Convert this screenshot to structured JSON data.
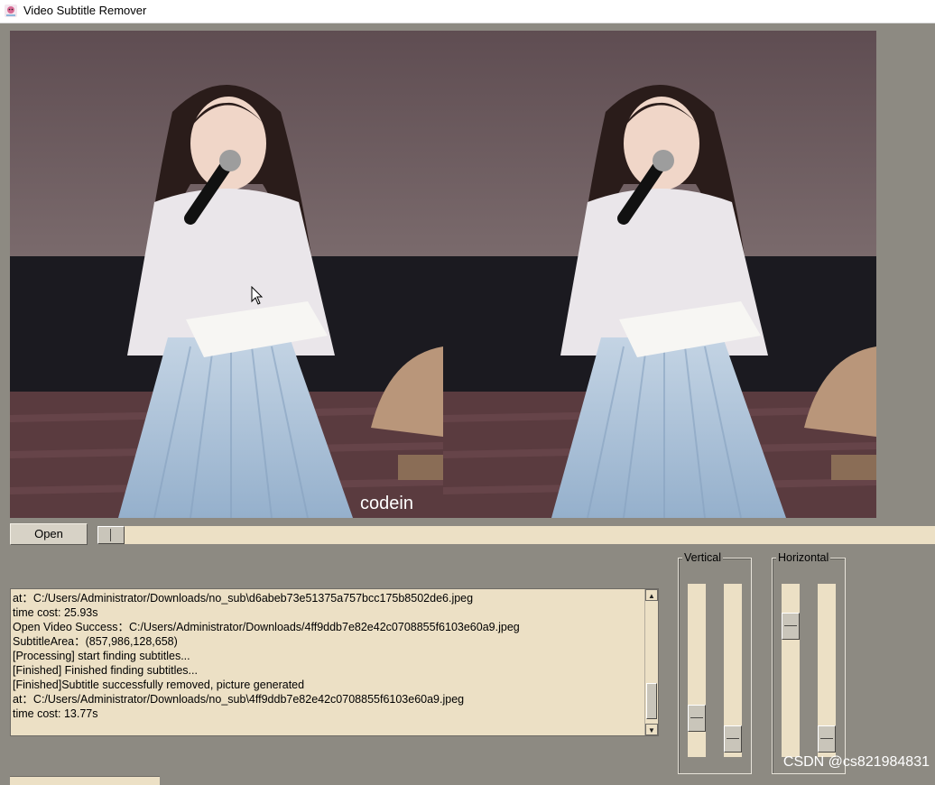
{
  "window": {
    "title": "Video Subtitle Remover",
    "icon": "app-icon"
  },
  "preview": {
    "left_frame": "original-frame",
    "right_frame": "processed-frame",
    "logo_text": "codein"
  },
  "controls": {
    "open_label": "Open",
    "progress": 0
  },
  "log": {
    "lines": [
      "at：C:/Users/Administrator/Downloads/no_sub\\d6abeb73e51375a757bcc175b8502de6.jpeg",
      "time cost: 25.93s",
      "Open Video Success：C:/Users/Administrator/Downloads/4ff9ddb7e82e42c0708855f6103e60a9.jpeg",
      "SubtitleArea：(857,986,128,658)",
      "[Processing] start finding subtitles...",
      "[Finished] Finished finding subtitles...",
      "[Finished]Subtitle successfully removed, picture generated",
      "at：C:/Users/Administrator/Downloads/no_sub\\4ff9ddb7e82e42c0708855f6103e60a9.jpeg",
      "time cost: 13.77s"
    ],
    "scroll_up_glyph": "▲",
    "scroll_down_glyph": "▼"
  },
  "sliders": {
    "vertical_label": "Vertical",
    "horizontal_label": "Horizontal",
    "vertical": [
      {
        "name": "vertical-slider-1",
        "level": 0.83
      },
      {
        "name": "vertical-slider-2",
        "level": 0.97
      }
    ],
    "horizontal": [
      {
        "name": "horizontal-slider-1",
        "level": 0.2
      },
      {
        "name": "horizontal-slider-2",
        "level": 0.97
      }
    ]
  },
  "watermark": "CSDN @cs821984831",
  "colors": {
    "background": "#8d8a82",
    "panel": "#ece0c5",
    "dress": "#a9c0d8"
  }
}
